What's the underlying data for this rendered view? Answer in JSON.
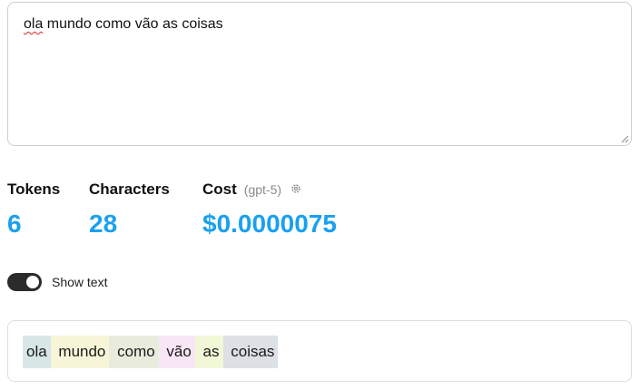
{
  "input": {
    "first_word": "ola",
    "rest_text": " mundo como vão as coisas"
  },
  "stats": {
    "tokens": {
      "label": "Tokens",
      "value": "6"
    },
    "characters": {
      "label": "Characters",
      "value": "28"
    },
    "cost": {
      "label": "Cost",
      "model": "(gpt-5)",
      "value": "$0.0000075"
    }
  },
  "toggle": {
    "label": "Show text",
    "on": true
  },
  "tokens_view": {
    "tokens": [
      {
        "text": "ola",
        "color": "#d6e7e6"
      },
      {
        "text": " mundo",
        "color": "#f6f5d8"
      },
      {
        "text": " como",
        "color": "#e9ecdd"
      },
      {
        "text": " vão",
        "color": "#f8e6f6"
      },
      {
        "text": " as",
        "color": "#f1f8d8"
      },
      {
        "text": " coisas",
        "color": "#dde0e5"
      }
    ]
  },
  "colors": {
    "accent": "#1aa0f0",
    "toggle_on": "#2b2b2b"
  }
}
